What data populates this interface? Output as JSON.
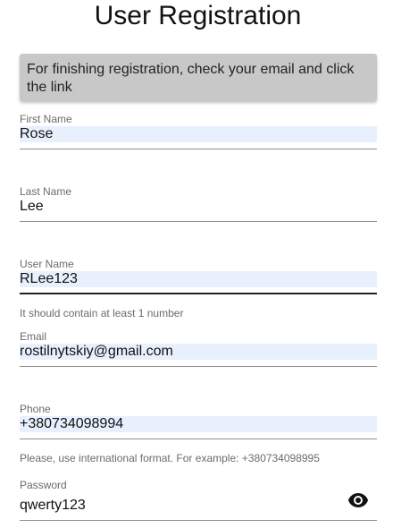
{
  "page": {
    "title": "User Registration"
  },
  "notice": {
    "text": "For finishing registration, check your email and click the link"
  },
  "fields": {
    "first_name": {
      "label": "First Name",
      "value": "Rose"
    },
    "last_name": {
      "label": "Last Name",
      "value": "Lee"
    },
    "user_name": {
      "label": "User Name",
      "value": "RLee123",
      "helper": "It should contain at least 1 number"
    },
    "email": {
      "label": "Email",
      "value": "rostilnytskiy@gmail.com"
    },
    "phone": {
      "label": "Phone",
      "value": "+380734098994",
      "helper": "Please, use international format. For example: +380734098995"
    },
    "password": {
      "label": "Password",
      "value": "qwerty123"
    }
  },
  "icons": {
    "password_toggle": "eye-icon"
  },
  "colors": {
    "autofill_background": "#e8f0fe",
    "notice_background": "#c8c8c8"
  }
}
